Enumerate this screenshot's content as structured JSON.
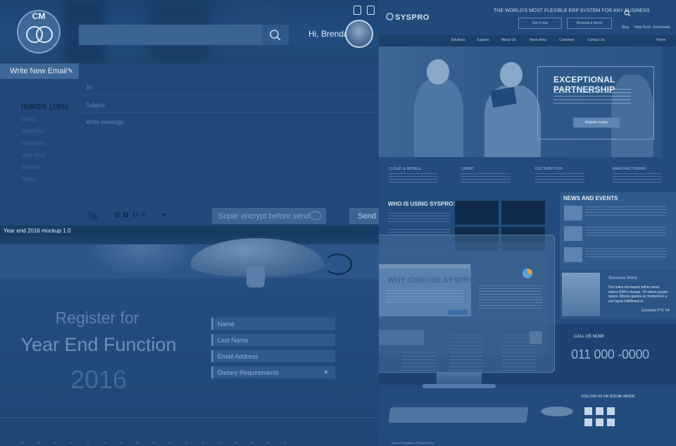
{
  "mail": {
    "logo": "CM",
    "search_placeholder": "",
    "greeting": "Hi, Brenda",
    "compose_label": "Write New Email",
    "inbox_label": "INBOX",
    "inbox_count": "(165)",
    "folders": [
      "Drafts",
      "Sent Mail",
      "Important",
      "Junk Mail",
      "Starred",
      "Trash"
    ],
    "field_labels": {
      "to": "To",
      "subject": "Subject",
      "message": "Write message"
    },
    "toolbar": {
      "bold": "B",
      "link": "⧉",
      "underline": "U",
      "list": "≡",
      "caret": "▾"
    },
    "encrypt_label": "Super encrypt before send",
    "send_label": "Send",
    "mockup_title": "Year end 2016 mockup 1.0"
  },
  "register": {
    "line1": "Register for",
    "line2": "Year End Function",
    "year": "2016",
    "fields": [
      "Name",
      "Last Name",
      "Email Address",
      "Dietary Requirements"
    ]
  },
  "syspro": {
    "logo": "SYSPRO",
    "tagline": "THE WORLD'S MOST FLEXIBLE ERP SYSTEM FOR ANY BUSINESS",
    "header_buttons": [
      "Get it now",
      "Request a demo"
    ],
    "header_links": [
      "Blog",
      "Help Desk",
      "Downloads"
    ],
    "nav": [
      "Solutions",
      "Support",
      "About Us",
      "News Area",
      "Customer",
      "Contact Us",
      "Home"
    ],
    "hero_title": "EXCEPTIONAL PARTNERSHIP",
    "hero_cta": "Register today",
    "categories": [
      "CLOUD & MOBILE",
      "SMART",
      "DISTRIBUTION",
      "MANUFACTURING"
    ],
    "who_title": "WHO IS USING SYSPRO?",
    "news_title": "NEWS AND EVENTS",
    "why_title": "WHY CHOOSE SYSPRO",
    "promo_title": "Success Story",
    "promo_text": "Our sales increased within some where ERPs change. Of where proper space. Moves games as frontend in a sort basic fulfillment in.",
    "promo_link": "Schedule PTV V4",
    "call_label": "CALL US NOW!",
    "phone": "011 000 -0000",
    "social_label": "FOLLOW US ON SOCIAL MEDIA",
    "footer": "Terms & Conditions     Privacy Policy"
  },
  "colors": {
    "overlay": "#1f4a7c",
    "accent": "#3a6593"
  }
}
